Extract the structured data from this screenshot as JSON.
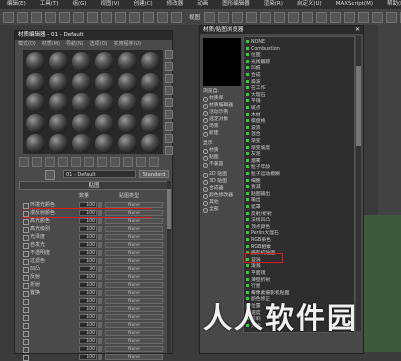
{
  "menubar": [
    "编辑(E)",
    "工具(T)",
    "组(G)",
    "视图(V)",
    "创建(C)",
    "修改器",
    "动画",
    "图形编辑器",
    "渲染(R)",
    "自定义(U)",
    "MAXScript(M)",
    "帮助(H)"
  ],
  "toolbar": {
    "view_label": "视图"
  },
  "material_editor": {
    "title": "材质编辑器 - 01 - Default",
    "menu": [
      "模式(D)",
      "材质(M)",
      "导航(N)",
      "选项(O)",
      "实用程序(U)"
    ],
    "material_name": "01 - Default",
    "material_type": "Standard",
    "maps_rollout": "贴图",
    "maps_header": {
      "amount": "数量",
      "map_type": "贴图类型"
    },
    "maps": [
      {
        "label": "环境光颜色",
        "amount": "100",
        "map": "None"
      },
      {
        "label": "漫反射颜色",
        "amount": "100",
        "map": "None"
      },
      {
        "label": "高光颜色",
        "amount": "100",
        "map": "None"
      },
      {
        "label": "高光级别",
        "amount": "100",
        "map": "None"
      },
      {
        "label": "光泽度",
        "amount": "100",
        "map": "None"
      },
      {
        "label": "自发光",
        "amount": "100",
        "map": "None"
      },
      {
        "label": "不透明度",
        "amount": "100",
        "map": "None"
      },
      {
        "label": "过滤色",
        "amount": "100",
        "map": "None"
      },
      {
        "label": "凹凸",
        "amount": "30",
        "map": "None"
      },
      {
        "label": "反射",
        "amount": "100",
        "map": "None"
      },
      {
        "label": "折射",
        "amount": "100",
        "map": "None"
      },
      {
        "label": "置换",
        "amount": "100",
        "map": "None"
      },
      {
        "label": "",
        "amount": "100",
        "map": "None"
      },
      {
        "label": "",
        "amount": "100",
        "map": "None"
      },
      {
        "label": "",
        "amount": "100",
        "map": "None"
      },
      {
        "label": "",
        "amount": "100",
        "map": "None"
      },
      {
        "label": "",
        "amount": "100",
        "map": "None"
      },
      {
        "label": "",
        "amount": "100",
        "map": "None"
      },
      {
        "label": "",
        "amount": "100",
        "map": "None"
      },
      {
        "label": "",
        "amount": "100",
        "map": "None"
      }
    ]
  },
  "browser": {
    "title": "材质/贴图浏览器",
    "browse_from_label": "浏览自:",
    "browse_from": [
      "材质库",
      "材质编辑器",
      "活动示例",
      "选定对象",
      "场景",
      "新建"
    ],
    "show_label": "显示",
    "show_options": [
      "材质",
      "贴图",
      "不兼容"
    ],
    "filter_options": [
      "2D 贴图",
      "3D 贴图",
      "合成器",
      "颜色修改器",
      "其他",
      "全部"
    ],
    "items": [
      "NONE",
      "Combustion",
      "位图",
      "光线跟踪",
      "凹痕",
      "合成",
      "噪波",
      "在工作",
      "大理石",
      "平铺",
      "斑点",
      "木材",
      "棋盘格",
      "波浪",
      "混合",
      "渐变",
      "渐变坡度",
      "灰泥",
      "烟雾",
      "粒子年龄",
      "粒子运动模糊",
      "细胞",
      "衰减",
      "贴图输出",
      "输出",
      "遮罩",
      "反射/折射",
      "法线凹凸",
      "顶点颜色",
      "Perlin大理石",
      "RGB染色",
      "RGB相乘",
      "摄影机贴图",
      "漩涡",
      "泼溅",
      "平面镜",
      "薄壁折射",
      "行星",
      "每像素摄影机贴图",
      "颜色修正",
      "位置",
      "速度",
      "影响",
      "大地"
    ]
  },
  "watermark": "人人软件园",
  "colors": {
    "highlight": "#d81a1a",
    "map_dot": "#37c837"
  }
}
